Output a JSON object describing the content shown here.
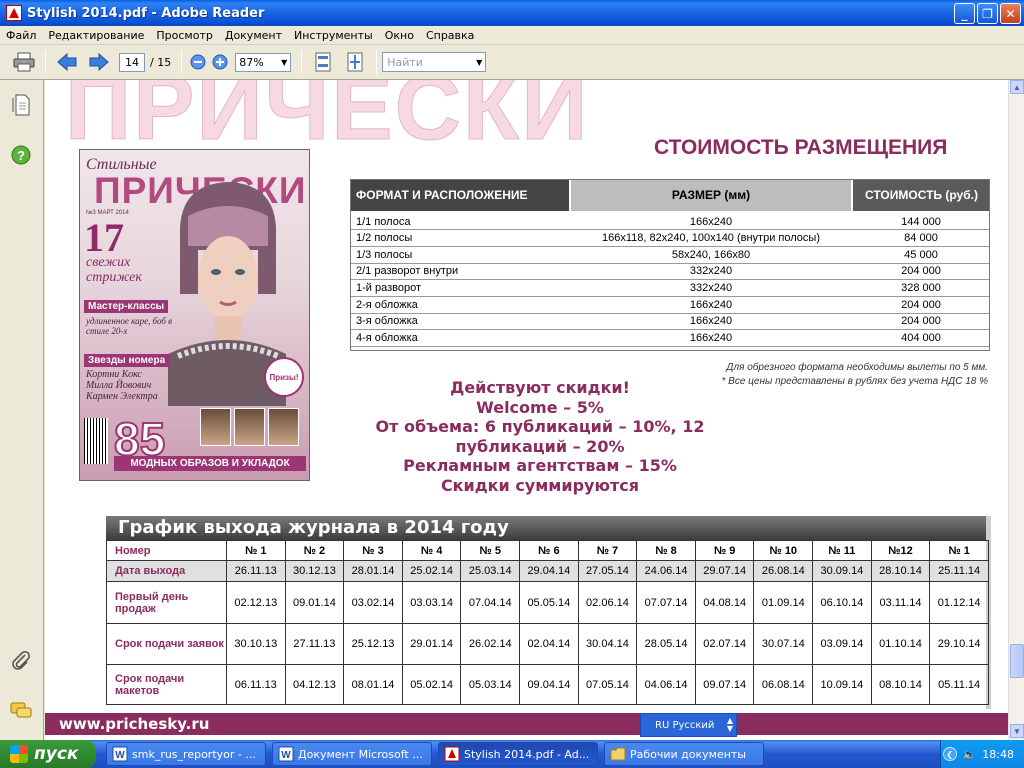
{
  "window": {
    "title": "Stylish 2014.pdf - Adobe Reader",
    "minimize": "_",
    "restore": "❐",
    "close": "✕"
  },
  "menu": [
    "Файл",
    "Редактирование",
    "Просмотр",
    "Документ",
    "Инструменты",
    "Окно",
    "Справка"
  ],
  "toolbar": {
    "page_current": "14",
    "page_sep": "/",
    "page_total": "15",
    "zoom": "87%",
    "find_placeholder": "Найти"
  },
  "doc": {
    "big_heading": "ПРИЧЕСКИ",
    "price_title": "СТОИМОСТЬ РАЗМЕЩЕНИЯ",
    "cover": {
      "logo": "Стильные",
      "title": "ПРИЧЕСКИ",
      "issue": "№3 МАРТ 2014",
      "number": "17",
      "number_sub": "свежих стрижек",
      "tag1": "Мастер-классы",
      "tag1_sub": "удлиненное каре, боб в стиле 20-х",
      "tag2": "Звезды номера",
      "stars": "Кортни Кокс Милла Йовович Кармен Электра",
      "prizes": "Призы!",
      "big": "85",
      "big_sub": "МОДНЫХ ОБРАЗОВ И УКЛАДОК"
    },
    "price_table": {
      "headers": [
        "ФОРМАТ И РАСПОЛОЖЕНИЕ",
        "РАЗМЕР (мм)",
        "СТОИМОСТЬ (руб.)"
      ],
      "rows": [
        [
          "1/1 полоса",
          "166x240",
          "144 000"
        ],
        [
          "1/2 полосы",
          "166x118, 82x240, 100x140 (внутри полосы)",
          "84 000"
        ],
        [
          "1/3 полосы",
          "58x240, 166x80",
          "45 000"
        ],
        [
          "2/1 разворот внутри",
          "332x240",
          "204 000"
        ],
        [
          "1-й разворот",
          "332x240",
          "328 000"
        ],
        [
          "2-я обложка",
          "166x240",
          "204 000"
        ],
        [
          "3-я обложка",
          "166x240",
          "204 000"
        ],
        [
          "4-я обложка",
          "166x240",
          "404 000"
        ]
      ]
    },
    "note1": "Для обрезного формата необходимы вылеты по 5 мм.",
    "note2": "* Все цены представлены в рублях без учета НДС 18 %",
    "discounts": [
      "Действуют скидки!",
      "Welcome – 5%",
      "От объема: 6 публикаций – 10%, 12",
      "публикаций – 20%",
      "Рекламным агентствам – 15%",
      "Скидки суммируются"
    ],
    "schedule": {
      "title": "График выхода журнала в 2014 году",
      "row_labels": [
        "Номер",
        "Дата выхода",
        "Первый день продаж",
        "Срок подачи заявок",
        "Срок подачи макетов"
      ],
      "issues": [
        "№ 1",
        "№ 2",
        "№ 3",
        "№ 4",
        "№ 5",
        "№ 6",
        "№ 7",
        "№ 8",
        "№ 9",
        "№ 10",
        "№ 11",
        "№12",
        "№ 1"
      ],
      "release": [
        "26.11.13",
        "30.12.13",
        "28.01.14",
        "25.02.14",
        "25.03.14",
        "29.04.14",
        "27.05.14",
        "24.06.14",
        "29.07.14",
        "26.08.14",
        "30.09.14",
        "28.10.14",
        "25.11.14"
      ],
      "first_sale": [
        "02.12.13",
        "09.01.14",
        "03.02.14",
        "03.03.14",
        "07.04.14",
        "05.05.14",
        "02.06.14",
        "07.07.14",
        "04.08.14",
        "01.09.14",
        "06.10.14",
        "03.11.14",
        "01.12.14"
      ],
      "orders": [
        "30.10.13",
        "27.11.13",
        "25.12.13",
        "29.01.14",
        "26.02.14",
        "02.04.14",
        "30.04.14",
        "28.05.14",
        "02.07.14",
        "30.07.14",
        "03.09.14",
        "01.10.14",
        "29.10.14"
      ],
      "layouts": [
        "06.11.13",
        "04.12.13",
        "08.01.14",
        "05.02.14",
        "05.03.14",
        "09.04.14",
        "07.05.14",
        "04.06.14",
        "09.07.14",
        "06.08.14",
        "10.09.14",
        "08.10.14",
        "05.11.14"
      ]
    },
    "website": "www.prichesky.ru"
  },
  "langbar": {
    "label": "RU Русский"
  },
  "taskbar": {
    "start": "пуск",
    "tasks": [
      {
        "label": "smk_rus_reportyor - ...",
        "active": false
      },
      {
        "label": "Документ Microsoft ...",
        "active": false
      },
      {
        "label": "Stylish 2014.pdf - Ad...",
        "active": true
      },
      {
        "label": "Рабочии документы",
        "active": false
      }
    ],
    "clock": "18:48"
  },
  "colors": {
    "accent": "#8a2c5e",
    "titlebar": "#0a5ee0",
    "taskbar": "#2457cf"
  }
}
